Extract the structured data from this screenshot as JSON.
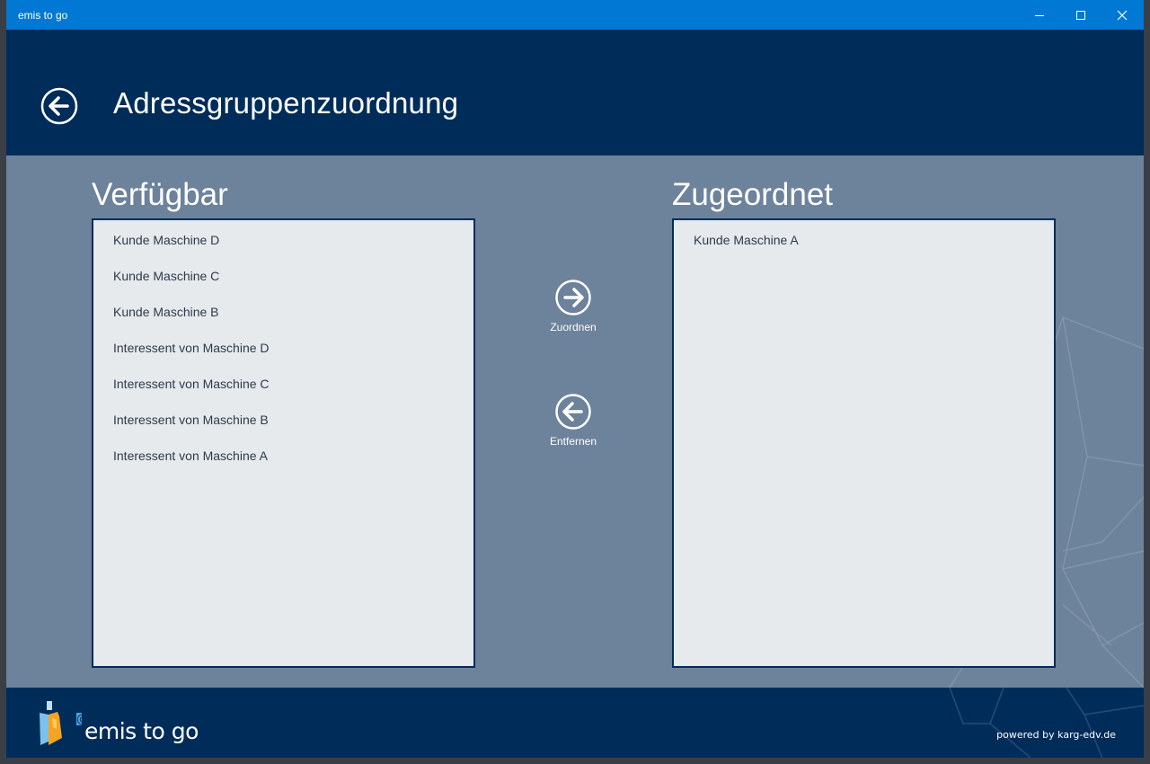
{
  "window": {
    "title": "emis to go",
    "controls": [
      "minimize-icon",
      "maximize-icon",
      "close-icon"
    ]
  },
  "header": {
    "back_icon": "arrow-left-circle-icon",
    "title": "Adressgruppenzuordnung"
  },
  "available": {
    "heading": "Verfügbar",
    "items": [
      "Kunde Maschine D",
      "Kunde Maschine C",
      "Kunde Maschine B",
      "Interessent von Maschine D",
      "Interessent von Maschine C",
      "Interessent von Maschine B",
      "Interessent von Maschine A"
    ]
  },
  "assigned": {
    "heading": "Zugeordnet",
    "items": [
      "Kunde Maschine A"
    ]
  },
  "actions": {
    "assign": {
      "label": "Zuordnen",
      "icon": "arrow-right-circle-icon"
    },
    "remove": {
      "label": "Entfernen",
      "icon": "arrow-left-circle-icon"
    }
  },
  "footer": {
    "logo_text": "emis to go",
    "logo_icon": "emis-logo-icon",
    "powered_by": "powered by karg-edv.de"
  },
  "colors": {
    "titlebar": "#0078d4",
    "header": "#002c5a",
    "content": "#6d829b",
    "listbox": "#e6eaed",
    "footer": "#002c5a"
  }
}
